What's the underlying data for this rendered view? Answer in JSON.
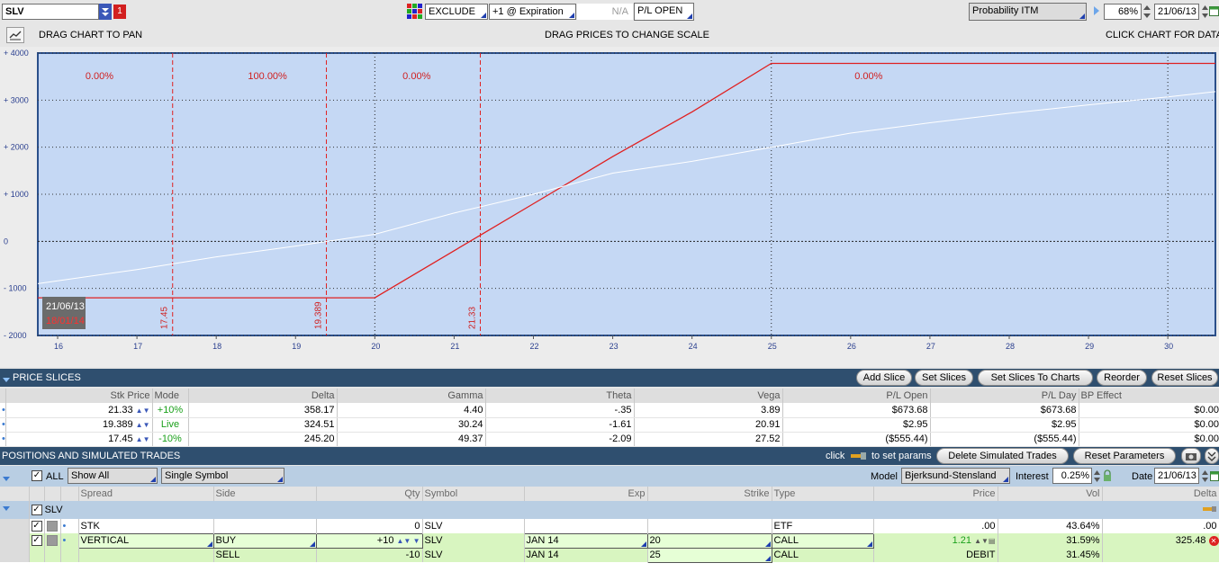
{
  "topbar": {
    "symbol": "SLV",
    "flag": "1",
    "exclude_label": "EXCLUDE",
    "expiration_label": "+1 @ Expiration",
    "na_label": "N/A",
    "pl_mode": "P/L OPEN",
    "probability_label": "Probability ITM",
    "probability_value": "68%",
    "date": "21/06/13"
  },
  "chartbar": {
    "pan_hint": "DRAG CHART TO PAN",
    "scale_hint": "DRAG PRICES TO CHANGE SCALE",
    "data_hint": "CLICK CHART FOR DATA"
  },
  "chart_data": {
    "type": "line",
    "xlim": [
      15.75,
      30.6
    ],
    "ylim": [
      -2000,
      4000
    ],
    "x_ticks": [
      "16",
      "17",
      "18",
      "19",
      "20",
      "21",
      "22",
      "23",
      "24",
      "25",
      "26",
      "27",
      "28",
      "29",
      "30"
    ],
    "y_ticks": [
      "+ 4000",
      "+ 3000",
      "+ 2000",
      "+ 1000",
      "0",
      "- 1000",
      "- 2000"
    ],
    "y_tick_values": [
      4000,
      3000,
      2000,
      1000,
      0,
      -1000,
      -2000
    ],
    "grid": true,
    "series": [
      {
        "color": "#e02020",
        "x": [
          15.75,
          20,
          21,
          22,
          23,
          24,
          25,
          30.6
        ],
        "y": [
          -1200,
          -1200,
          -200,
          800,
          1800,
          2750,
          3780,
          3780
        ]
      },
      {
        "color": "#ffffff",
        "x": [
          15.75,
          17,
          18,
          19,
          20,
          21,
          22,
          23,
          24,
          25,
          26,
          27,
          28,
          29,
          30,
          30.6
        ],
        "y": [
          -900,
          -600,
          -330,
          -100,
          150,
          600,
          1000,
          1450,
          1700,
          2000,
          2300,
          2520,
          2720,
          2900,
          3070,
          3180
        ]
      }
    ],
    "zone_labels": [
      "0.00%",
      "100.00%",
      "0.00%",
      "0.00%"
    ],
    "zone_label_x": [
      16.35,
      18.4,
      20.35,
      26.05
    ],
    "slice_lines": [
      {
        "x": 17.45,
        "label": "17.45"
      },
      {
        "x": 19.389,
        "label": "19.389"
      },
      {
        "x": 21.33,
        "label": "21.33"
      }
    ],
    "strike_lines": [
      20,
      25
    ],
    "vertical_marks": [
      30
    ],
    "date_badge": [
      "21/06/13",
      "18/01/14"
    ]
  },
  "price_slices": {
    "title": "PRICE SLICES",
    "buttons": [
      "Add Slice",
      "Set Slices",
      "Set Slices To Charts",
      "Reorder",
      "Reset Slices"
    ],
    "columns": [
      "Stk Price",
      "Mode",
      "Delta",
      "Gamma",
      "Theta",
      "Vega",
      "P/L Open",
      "P/L Day",
      "BP Effect"
    ],
    "rows": [
      [
        "21.33",
        "+10%",
        "358.17",
        "4.40",
        "-.35",
        "3.89",
        "$673.68",
        "$673.68",
        "$0.00"
      ],
      [
        "19.389",
        "Live",
        "324.51",
        "30.24",
        "-1.61",
        "20.91",
        "$2.95",
        "$2.95",
        "$0.00"
      ],
      [
        "17.45",
        "-10%",
        "245.20",
        "49.37",
        "-2.09",
        "27.52",
        "($555.44)",
        "($555.44)",
        "$0.00"
      ]
    ]
  },
  "positions": {
    "title": "POSITIONS AND SIMULATED TRADES",
    "click_label": "click",
    "set_params_label": "to set params",
    "delete_button": "Delete Simulated Trades",
    "reset_button": "Reset Parameters",
    "all_label": "ALL",
    "show_all": "Show All",
    "single_symbol": "Single Symbol",
    "model_label": "Model",
    "model_value": "Bjerksund-Stensland",
    "interest_label": "Interest",
    "interest_value": "0.25%",
    "date_label": "Date",
    "date_value": "21/06/13",
    "columns": [
      "Spread",
      "Side",
      "Qty",
      "Symbol",
      "Exp",
      "Strike",
      "Type",
      "Price",
      "Vol",
      "Delta"
    ],
    "group": "SLV",
    "rows": [
      [
        "STK",
        "",
        "0",
        "SLV",
        "",
        "",
        "ETF",
        ".00",
        "43.64%",
        ".00"
      ],
      [
        "VERTICAL",
        "BUY",
        "+10",
        "SLV",
        "JAN 14",
        "20",
        "CALL",
        "1.21",
        "31.59%",
        "325.48"
      ],
      [
        "",
        "SELL",
        "-10",
        "SLV",
        "JAN 14",
        "25",
        "CALL",
        "DEBIT",
        "31.45%",
        ""
      ]
    ]
  },
  "colors": {
    "plot_bg": "#c5d8f4",
    "header_blue": "#2f4f6f",
    "pnl_line": "#e02020",
    "sim_row": "#d8f5c0"
  }
}
